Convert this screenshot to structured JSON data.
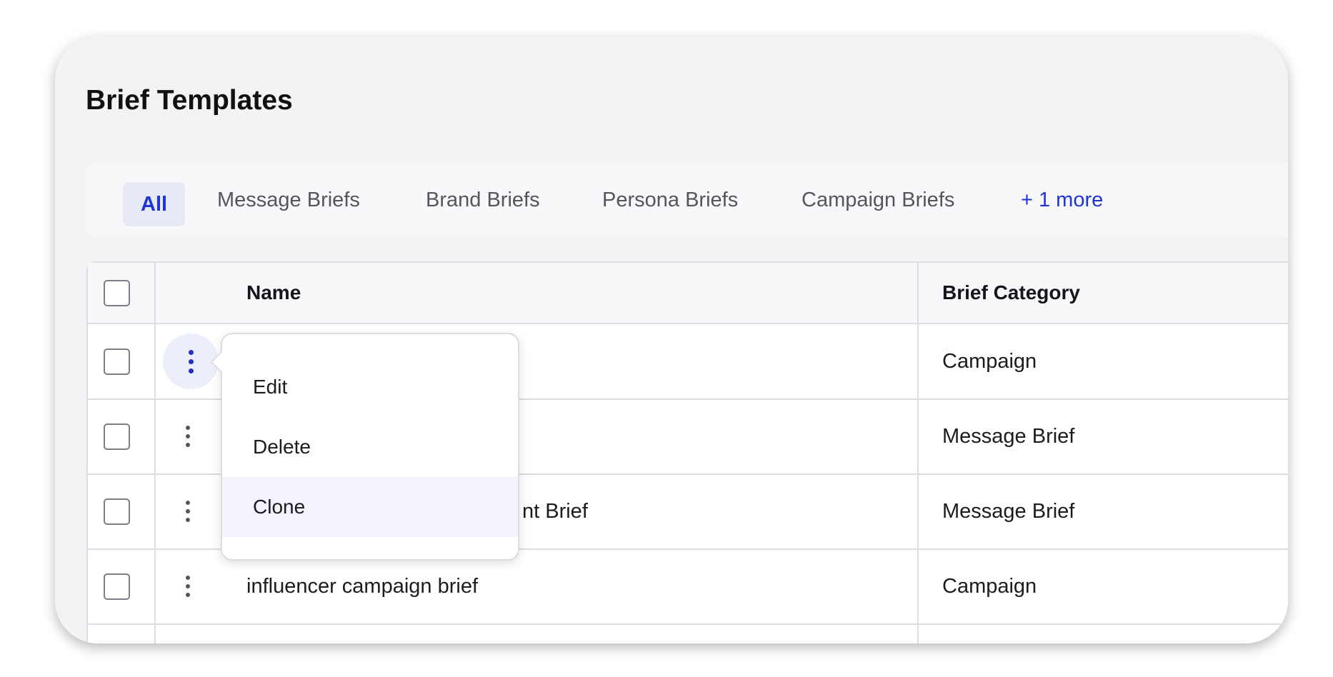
{
  "title": "Brief Templates",
  "tabs": [
    {
      "label": "All",
      "active": true
    },
    {
      "label": "Message Briefs"
    },
    {
      "label": "Brand Briefs"
    },
    {
      "label": "Persona Briefs"
    },
    {
      "label": "Campaign Briefs"
    },
    {
      "label": "+ 1 more"
    }
  ],
  "table": {
    "columns": [
      "Name",
      "Brief Category"
    ],
    "rows": [
      {
        "name": "",
        "category": "Campaign"
      },
      {
        "name": "",
        "category": "Message Brief"
      },
      {
        "name": "nt Brief",
        "category": "Message Brief"
      },
      {
        "name": "influencer campaign brief",
        "category": "Campaign"
      }
    ]
  },
  "row_menu": {
    "items": [
      "Edit",
      "Delete",
      "Clone"
    ],
    "highlighted": "Clone"
  },
  "colors": {
    "accent": "#1f35d6",
    "background": "#f3f3f5"
  }
}
